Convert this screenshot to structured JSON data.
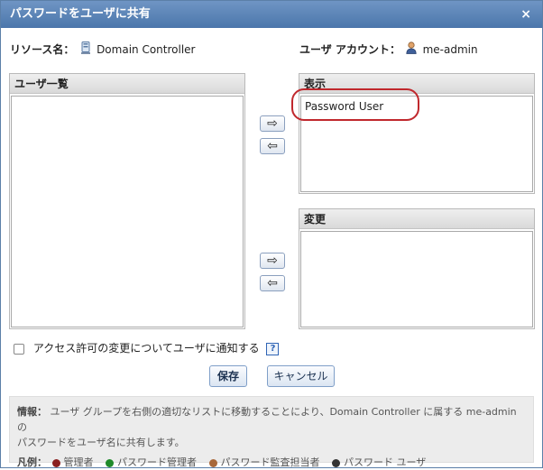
{
  "dialog": {
    "title": "パスワードをユーザに共有",
    "close_label": "×"
  },
  "resource": {
    "label": "リソース名：",
    "value": "Domain Controller",
    "icon": "server-icon"
  },
  "account": {
    "label": "ユーザ アカウント：",
    "value": "me-admin",
    "icon": "user-icon"
  },
  "user_list": {
    "header": "ユーザ一覧",
    "items": []
  },
  "view_list": {
    "header": "表示",
    "items": [
      "Password User"
    ]
  },
  "modify_list": {
    "header": "変更",
    "items": []
  },
  "arrows": {
    "right": "⇨",
    "left": "⇦"
  },
  "notify": {
    "label": "アクセス許可の変更についてユーザに通知する",
    "checked": false,
    "help": "?"
  },
  "buttons": {
    "save": "保存",
    "cancel": "キャンセル"
  },
  "info": {
    "label": "情報：",
    "text_line1": "ユーザ グループを右側の適切なリストに移動することにより、Domain Controller に属する me-admin の",
    "text_line2": "パスワードをユーザ名に共有します。"
  },
  "legend": {
    "label": "凡例：",
    "items": [
      {
        "name": "管理者",
        "color": "#8a1f1f"
      },
      {
        "name": "パスワード管理者",
        "color": "#1f8a2a"
      },
      {
        "name": "パスワード監査担当者",
        "color": "#a8683a"
      },
      {
        "name": "パスワード ユーザ",
        "color": "#333333"
      }
    ]
  },
  "colors": {
    "title_bar": "#5a82b6",
    "highlight": "#c0282d"
  }
}
